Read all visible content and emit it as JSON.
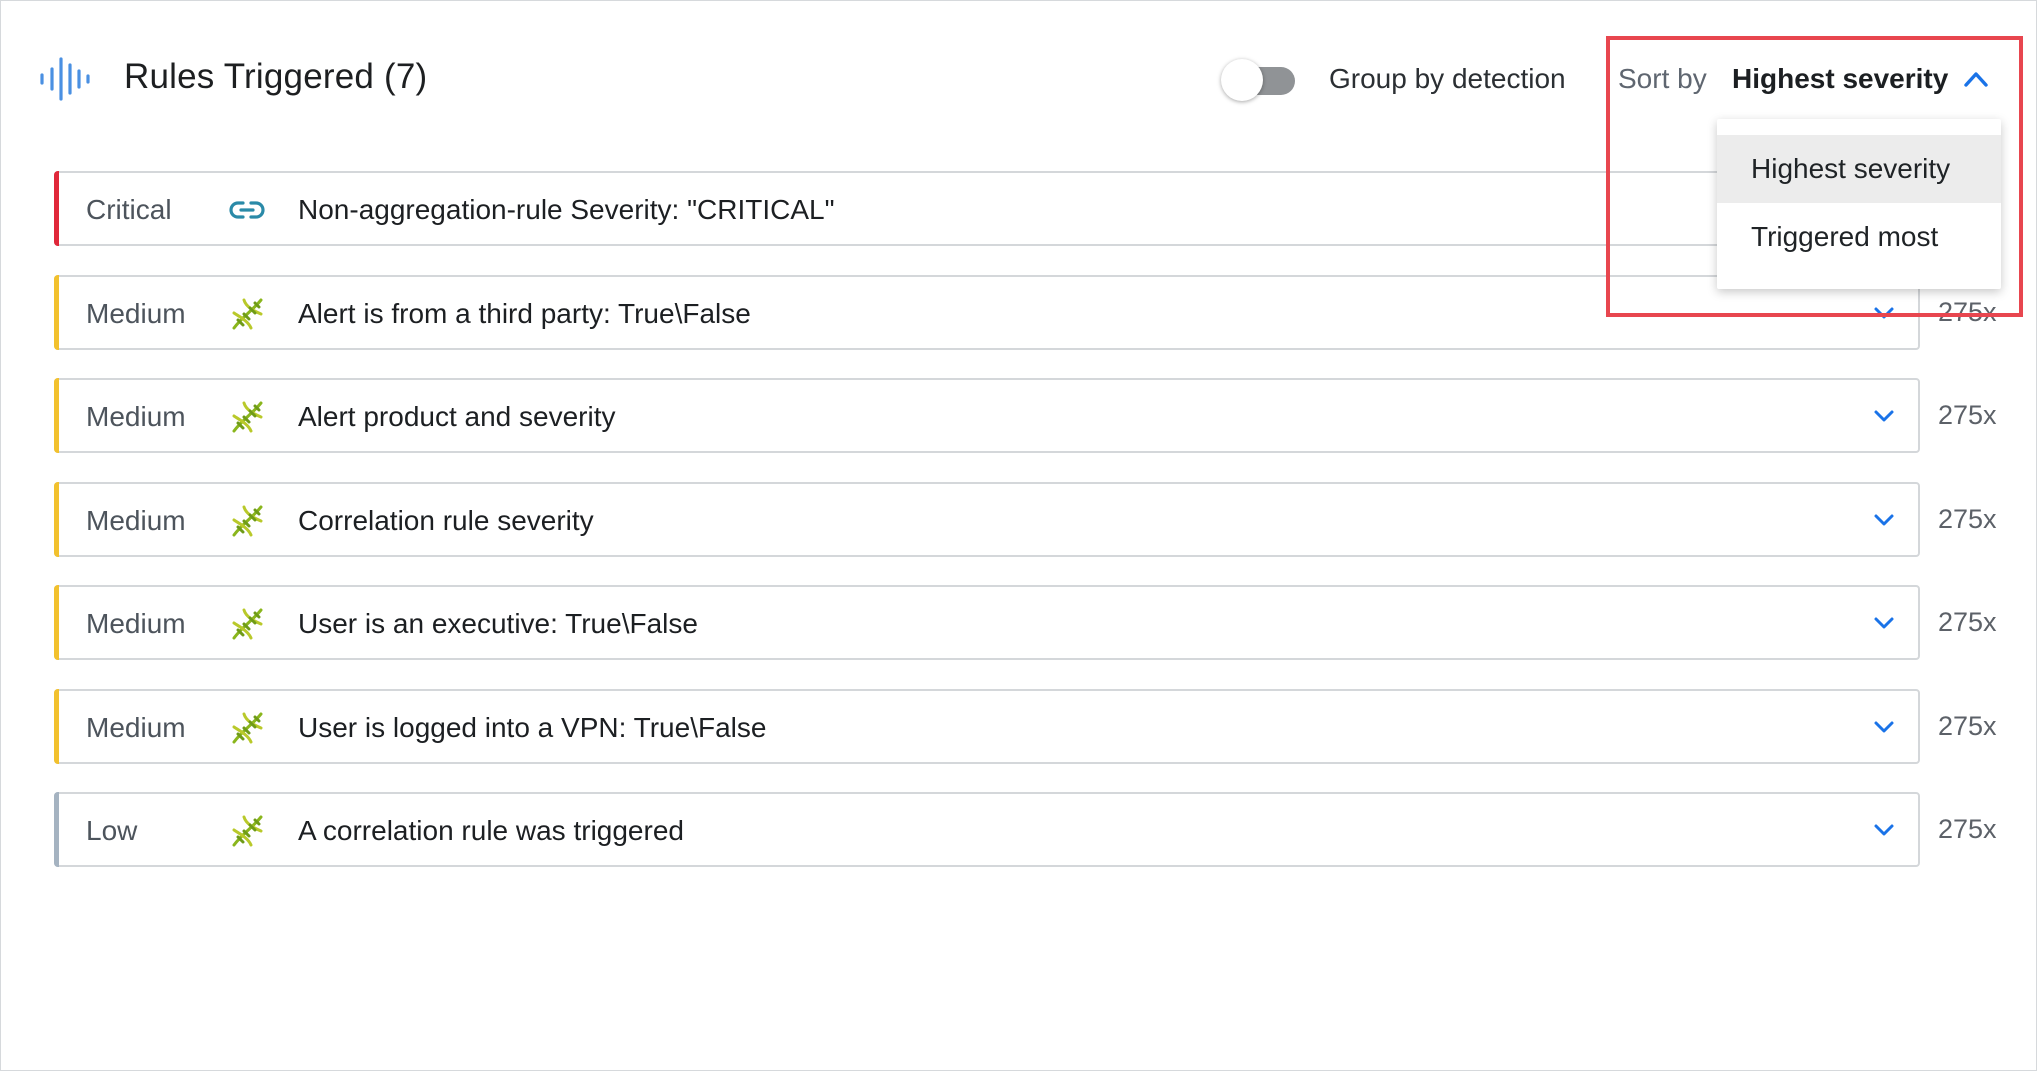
{
  "header": {
    "title": "Rules Triggered (7)",
    "icon": "audio-waveform-icon",
    "group_toggle": {
      "label": "Group by detection",
      "on": false
    },
    "sort": {
      "label": "Sort by",
      "value": "Highest severity",
      "expanded": true,
      "options": [
        "Highest severity",
        "Triggered most"
      ],
      "selected_index": 0
    }
  },
  "colors": {
    "critical": "#e0283a",
    "medium": "#f2c12e",
    "low": "#a5b3c1",
    "accent": "#1a73e8",
    "highlight": "#e8464f"
  },
  "rules": [
    {
      "severity": "Critical",
      "icon": "link-icon",
      "title": "Non-aggregation-rule Severity: \"CRITICAL\"",
      "count": ""
    },
    {
      "severity": "Medium",
      "icon": "dna-icon",
      "title": "Alert is from a third party: True\\False",
      "count": "275x"
    },
    {
      "severity": "Medium",
      "icon": "dna-icon",
      "title": "Alert product and severity",
      "count": "275x"
    },
    {
      "severity": "Medium",
      "icon": "dna-icon",
      "title": "Correlation rule severity",
      "count": "275x"
    },
    {
      "severity": "Medium",
      "icon": "dna-icon",
      "title": "User is an executive: True\\False",
      "count": "275x"
    },
    {
      "severity": "Medium",
      "icon": "dna-icon",
      "title": "User is logged into a VPN: True\\False",
      "count": "275x"
    },
    {
      "severity": "Low",
      "icon": "dna-icon",
      "title": "A correlation rule was triggered",
      "count": "275x"
    }
  ]
}
